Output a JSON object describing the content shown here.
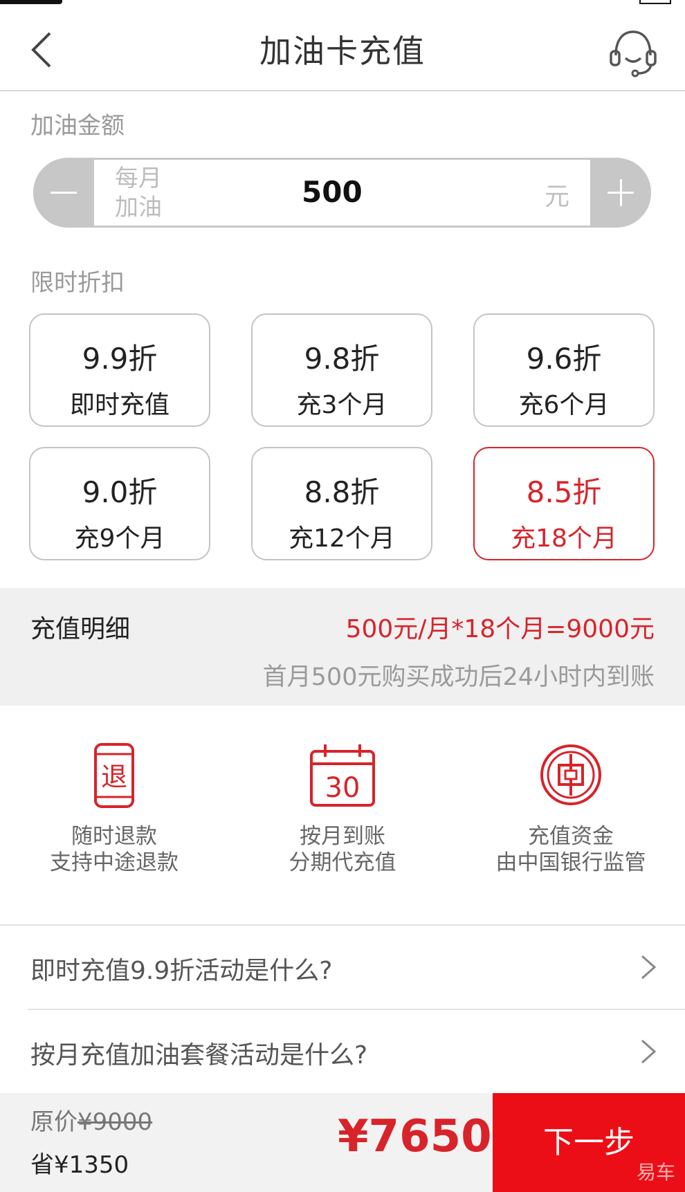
{
  "nav": {
    "title": "加油卡充值"
  },
  "amount": {
    "section_label": "加油金额",
    "hint": "每月加油",
    "value": "500",
    "unit": "元"
  },
  "discount": {
    "section_label": "限时折扣",
    "options": [
      {
        "rate": "9.9折",
        "plan": "即时充值",
        "selected": false
      },
      {
        "rate": "9.8折",
        "plan": "充3个月",
        "selected": false
      },
      {
        "rate": "9.6折",
        "plan": "充6个月",
        "selected": false
      },
      {
        "rate": "9.0折",
        "plan": "充9个月",
        "selected": false
      },
      {
        "rate": "8.8折",
        "plan": "充12个月",
        "selected": false
      },
      {
        "rate": "8.5折",
        "plan": "充18个月",
        "selected": true
      }
    ]
  },
  "detail": {
    "label": "充值明细",
    "formula": "500元/月*18个月=9000元",
    "note": "首月500元购买成功后24小时内到账"
  },
  "features": [
    {
      "icon": "refund-phone-icon",
      "glyph": "退",
      "line1": "随时退款",
      "line2": "支持中途退款"
    },
    {
      "icon": "calendar-icon",
      "glyph": "30",
      "line1": "按月到账",
      "line2": "分期代充值"
    },
    {
      "icon": "bank-coin-icon",
      "line1": "充值资金",
      "line2": "由中国银行监管"
    }
  ],
  "faq": [
    {
      "question": "即时充值9.9折活动是什么?"
    },
    {
      "question": "按月充值加油套餐活动是什么?"
    }
  ],
  "bottom": {
    "orig_label": "原价",
    "orig_price": "¥9000",
    "saving": "省¥1350",
    "total": "¥7650",
    "next_label": "下一步",
    "watermark": "易车"
  },
  "colors": {
    "accent": "#d8232a",
    "button": "#ec0e16",
    "stepper": "#c7c7c7"
  }
}
